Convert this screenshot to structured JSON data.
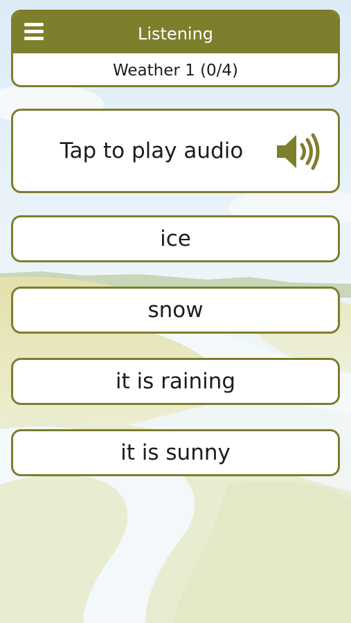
{
  "header": {
    "title": "Listening",
    "subtitle": "Weather 1 (0/4)",
    "menu_icon": "hamburger-menu-icon"
  },
  "audio": {
    "label": "Tap to play audio",
    "icon": "speaker-icon"
  },
  "answers": [
    {
      "label": "ice"
    },
    {
      "label": "snow"
    },
    {
      "label": "it is raining"
    },
    {
      "label": "it is sunny"
    }
  ],
  "colors": {
    "accent": "#7e7f2d",
    "card_background": "#ffffff",
    "text": "#1c1c1c",
    "sky": "#e6f1f8",
    "field": "#e8e3b6",
    "river": "#f2f8fb"
  }
}
